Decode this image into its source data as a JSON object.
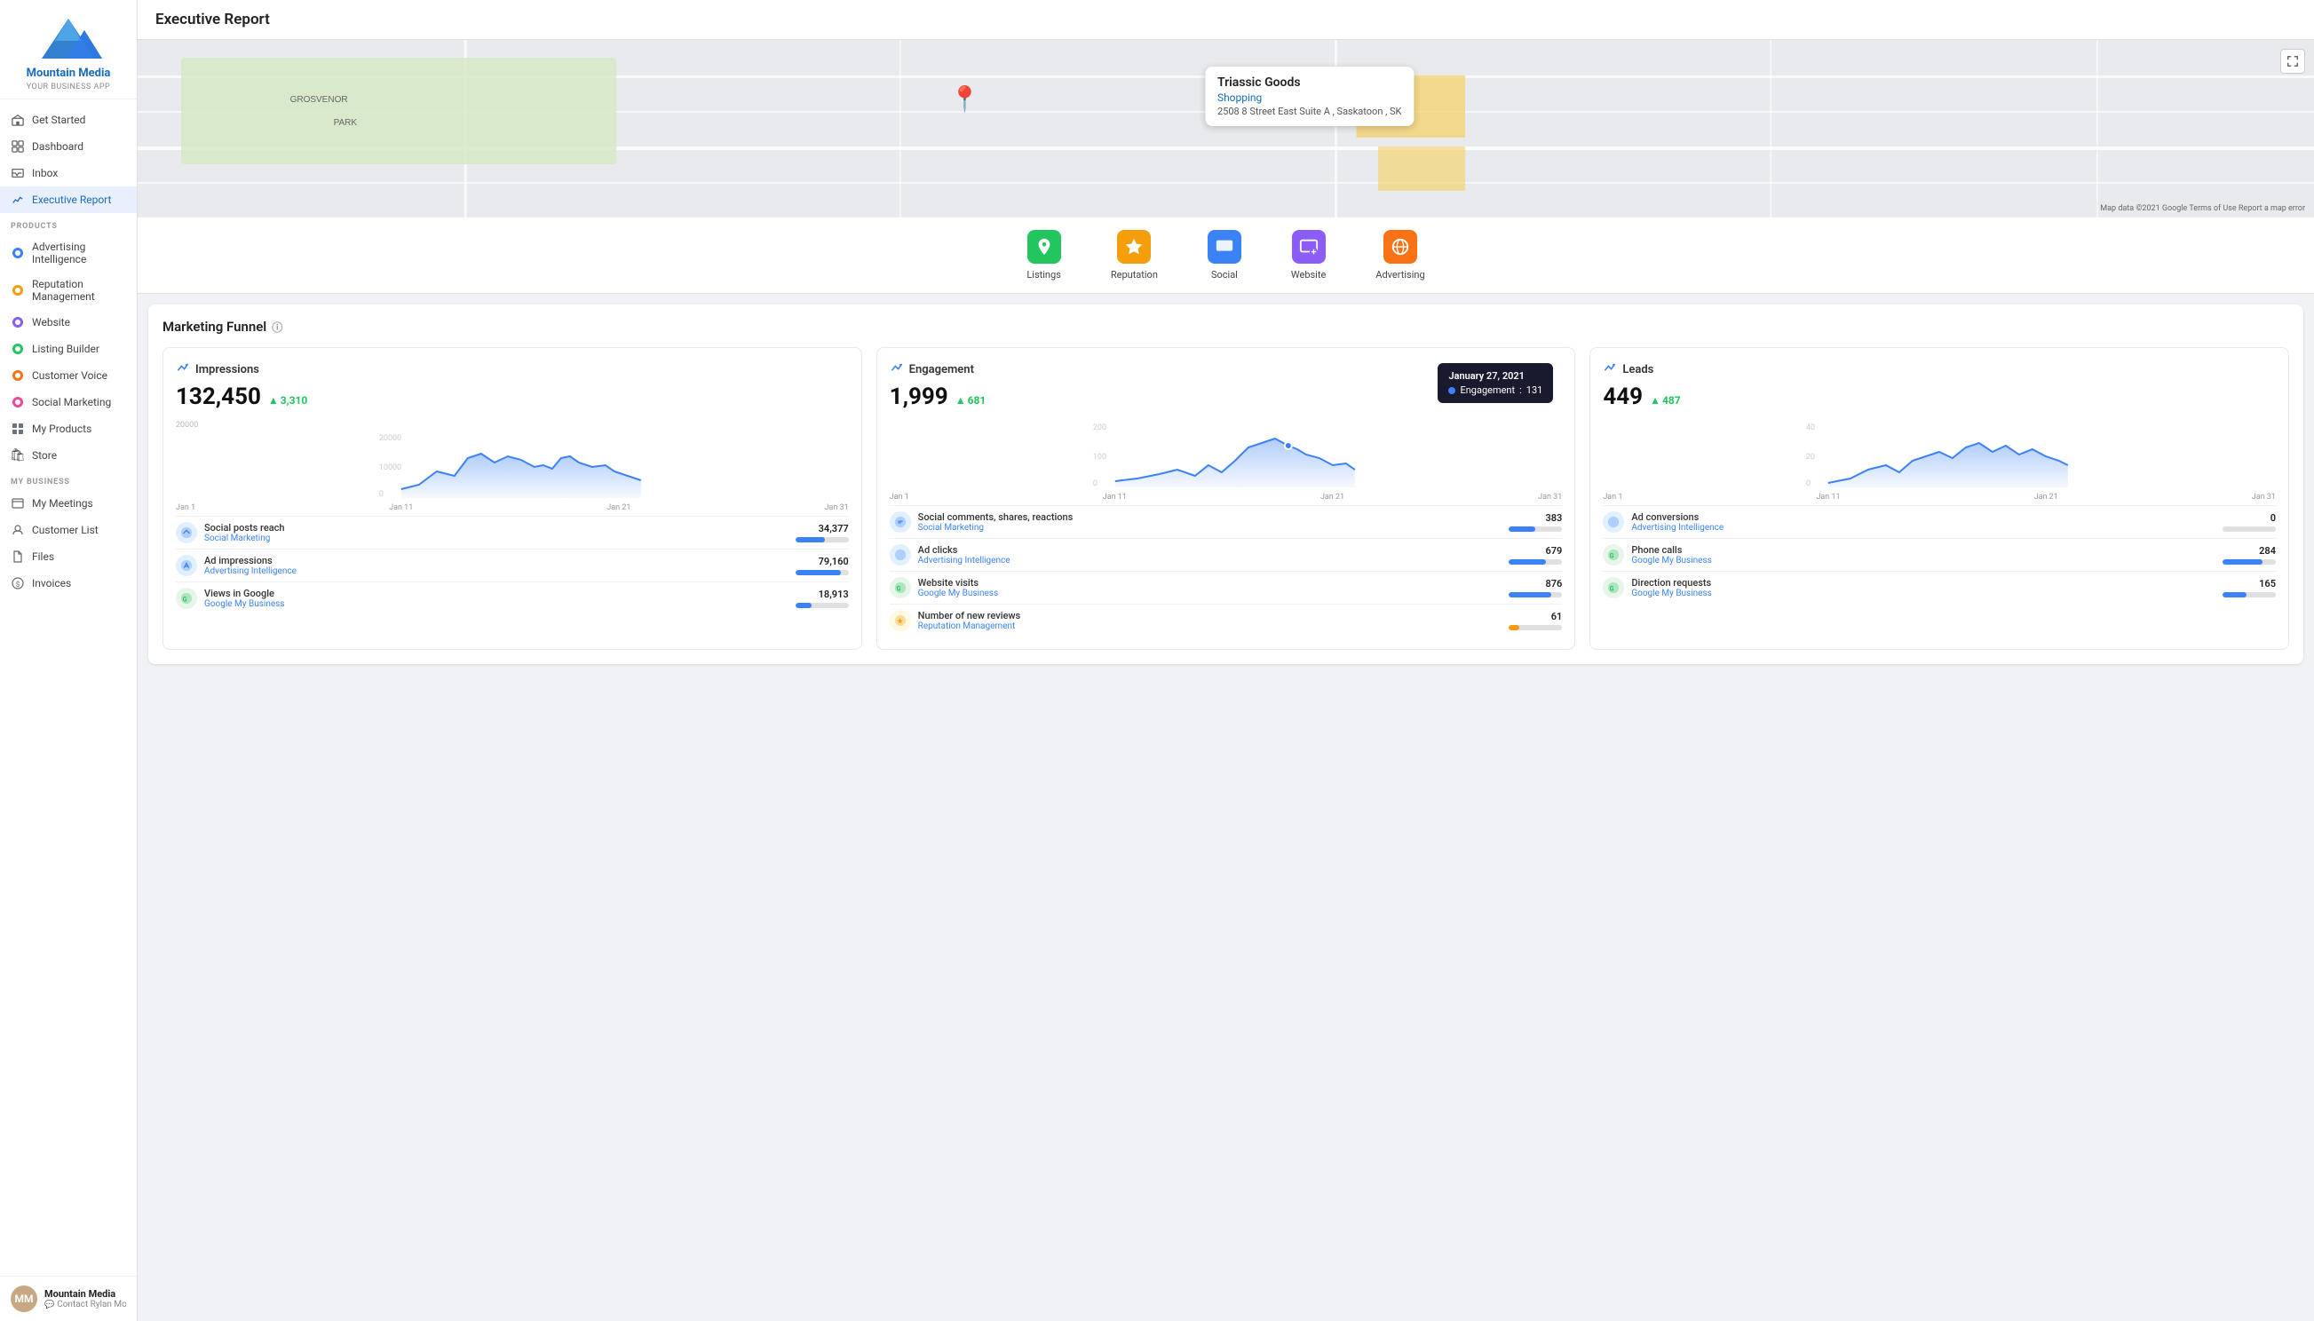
{
  "sidebar": {
    "logo": {
      "company": "Mountain Media",
      "tagline": "YOUR BUSINESS APP"
    },
    "nav_top": [
      {
        "id": "get-started",
        "label": "Get Started",
        "icon": "🏠"
      },
      {
        "id": "dashboard",
        "label": "Dashboard",
        "icon": "⊞"
      },
      {
        "id": "inbox",
        "label": "Inbox",
        "icon": "▭"
      },
      {
        "id": "executive-report",
        "label": "Executive Report",
        "icon": "📈",
        "active": true
      }
    ],
    "products_label": "PRODUCTS",
    "nav_products": [
      {
        "id": "advertising",
        "label": "Advertising Intelligence",
        "icon": "◉",
        "color": "#3b82f6"
      },
      {
        "id": "reputation",
        "label": "Reputation Management",
        "icon": "◉",
        "color": "#f59e0b"
      },
      {
        "id": "website",
        "label": "Website",
        "icon": "◉",
        "color": "#8b5cf6"
      },
      {
        "id": "listing",
        "label": "Listing Builder",
        "icon": "◉",
        "color": "#22c55e"
      },
      {
        "id": "customer-voice",
        "label": "Customer Voice",
        "icon": "◉",
        "color": "#f97316"
      },
      {
        "id": "social-marketing",
        "label": "Social Marketing",
        "icon": "◉",
        "color": "#ec4899"
      },
      {
        "id": "my-products",
        "label": "My Products",
        "icon": "⊞",
        "color": "#6b7280"
      },
      {
        "id": "store",
        "label": "Store",
        "icon": "🛍",
        "color": "#6b7280"
      }
    ],
    "my_business_label": "MY BUSINESS",
    "nav_business": [
      {
        "id": "my-meetings",
        "label": "My Meetings",
        "icon": "▭"
      },
      {
        "id": "customer-list",
        "label": "Customer List",
        "icon": "👤"
      },
      {
        "id": "files",
        "label": "Files",
        "icon": "📄"
      },
      {
        "id": "invoices",
        "label": "Invoices",
        "icon": "$"
      }
    ],
    "footer": {
      "name": "Mountain Media",
      "sub": "Contact Rylan Morris",
      "avatar_initials": "MM"
    }
  },
  "page": {
    "title": "Executive Report"
  },
  "map": {
    "business_name": "Triassic Goods",
    "category": "Shopping",
    "address": "2508 8 Street East Suite A , Saskatoon , SK",
    "attribution": "Map data ©2021 Google  Terms of Use  Report a map error"
  },
  "icon_nav": [
    {
      "id": "listings",
      "label": "Listings",
      "icon": "📍",
      "bg": "#22c55e"
    },
    {
      "id": "reputation",
      "label": "Reputation",
      "icon": "⭐",
      "bg": "#f59e0b"
    },
    {
      "id": "social",
      "label": "Social",
      "icon": "💬",
      "bg": "#3b82f6"
    },
    {
      "id": "website",
      "label": "Website",
      "icon": "🖥",
      "bg": "#8b5cf6"
    },
    {
      "id": "advertising",
      "label": "Advertising",
      "icon": "🌐",
      "bg": "#f97316"
    }
  ],
  "funnel": {
    "title": "Marketing Funnel",
    "columns": [
      {
        "id": "impressions",
        "title": "Impressions",
        "value": "132,450",
        "delta": "3,310",
        "delta_sign": "+",
        "chart_max": 20000,
        "chart_mid": 10000,
        "chart_labels": [
          "Jan 1",
          "Jan 11",
          "Jan 21",
          "Jan 31"
        ],
        "metrics": [
          {
            "name": "Social posts reach",
            "source": "Social Marketing",
            "value": "34,377",
            "bar_pct": 55,
            "icon": "🔵"
          },
          {
            "name": "Ad impressions",
            "source": "Advertising Intelligence",
            "value": "79,160",
            "bar_pct": 85,
            "icon": "🔵"
          },
          {
            "name": "Views in Google",
            "source": "Google My Business",
            "value": "18,913",
            "bar_pct": 30,
            "icon": "🟢"
          }
        ]
      },
      {
        "id": "engagement",
        "title": "Engagement",
        "value": "1,999",
        "delta": "681",
        "delta_sign": "+",
        "chart_max": 200,
        "chart_mid": 100,
        "chart_labels": [
          "Jan 1",
          "Jan 11",
          "Jan 21",
          "Jan 31"
        ],
        "tooltip": {
          "date": "January 27, 2021",
          "label": "Engagement",
          "value": "131"
        },
        "metrics": [
          {
            "name": "Social comments, shares, reactions",
            "source": "Social Marketing",
            "value": "383",
            "bar_pct": 50,
            "icon": "🔵"
          },
          {
            "name": "Ad clicks",
            "source": "Advertising Intelligence",
            "value": "679",
            "bar_pct": 70,
            "icon": "🔵"
          },
          {
            "name": "Website visits",
            "source": "Google My Business",
            "value": "876",
            "bar_pct": 80,
            "icon": "🟢"
          },
          {
            "name": "Number of new reviews",
            "source": "Reputation Management",
            "value": "61",
            "bar_pct": 20,
            "icon": "🟡"
          }
        ]
      },
      {
        "id": "leads",
        "title": "Leads",
        "value": "449",
        "delta": "487",
        "delta_sign": "+",
        "chart_max": 40,
        "chart_mid": 20,
        "chart_labels": [
          "Jan 1",
          "Jan 11",
          "Jan 21",
          "Jan 31"
        ],
        "metrics": [
          {
            "name": "Ad conversions",
            "source": "Advertising Intelligence",
            "value": "0",
            "bar_pct": 0,
            "icon": "🔵"
          },
          {
            "name": "Phone calls",
            "source": "Google My Business",
            "value": "284",
            "bar_pct": 75,
            "icon": "🟢"
          },
          {
            "name": "Direction requests",
            "source": "Google My Business",
            "value": "165",
            "bar_pct": 45,
            "icon": "🟢"
          }
        ]
      }
    ]
  }
}
